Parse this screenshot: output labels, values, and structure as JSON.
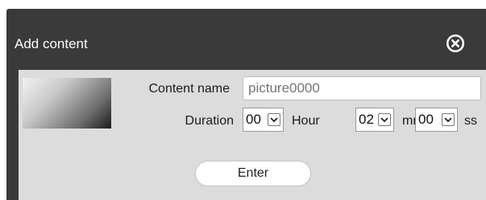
{
  "dialog": {
    "title": "Add content",
    "close_icon": "close-icon"
  },
  "form": {
    "name_label": "Content name",
    "name_placeholder": "picture0000",
    "name_value": "",
    "duration_label": "Duration",
    "hour_value": "00",
    "hour_unit": "Hour",
    "min_value": "02",
    "min_unit": "mm",
    "sec_value": "00",
    "sec_unit": "ss",
    "chevron_icon": "chevron-down-icon"
  },
  "actions": {
    "enter_label": "Enter"
  },
  "colors": {
    "dialog_bg": "#3a3a3a",
    "panel_bg": "#dcdcdc",
    "title_text": "#ffffff"
  }
}
